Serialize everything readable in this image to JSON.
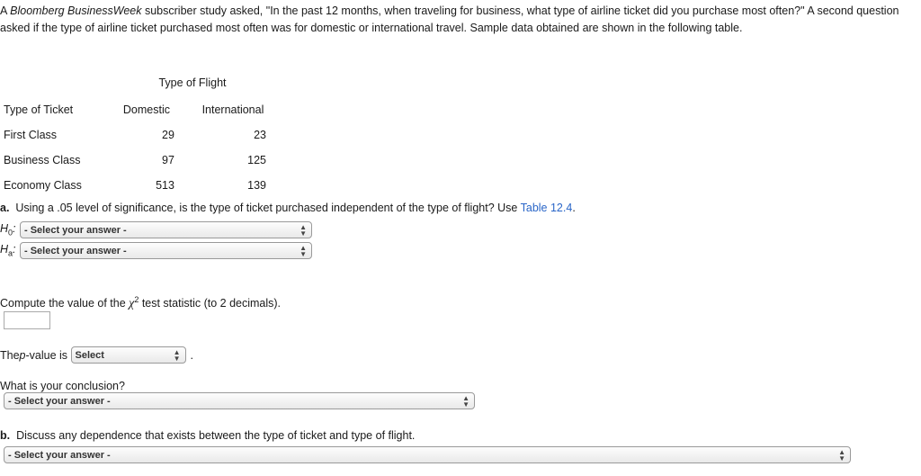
{
  "intro": {
    "line1_a": "A ",
    "brand": "Bloomberg BusinessWeek",
    "line1_b": " subscriber study asked, \"In the past 12 months, when traveling for business, what type of airline ticket did you purchase most often?\" A second question asked if the type of airline ticket purchased most often was for domestic or international travel. Sample data obtained are shown in the following table."
  },
  "table": {
    "span_header": "Type of Flight",
    "row_header": "Type of Ticket",
    "columns": [
      "Domestic",
      "International"
    ],
    "rows": [
      {
        "label": "First Class",
        "domestic": "29",
        "international": "23"
      },
      {
        "label": "Business Class",
        "domestic": "97",
        "international": "125"
      },
      {
        "label": "Economy Class",
        "domestic": "513",
        "international": "139"
      }
    ]
  },
  "part_a": {
    "marker": "a.",
    "text": "Using a .05 level of significance, is the type of ticket purchased independent of the type of flight? Use ",
    "link": "Table 12.4",
    "period": ".",
    "h0_label": "H",
    "h0_sub": "0",
    "h0_colon": ":",
    "ha_label": "H",
    "ha_sub": "a",
    "ha_colon": ":",
    "select_placeholder": "- Select your answer -"
  },
  "chi_question": {
    "before": "Compute the value of the ",
    "chi": "χ",
    "sup": "2",
    "after": " test statistic (to 2 decimals).",
    "answer_value": ""
  },
  "pvalue": {
    "prefix_a": "The ",
    "prefix_p": "p",
    "prefix_b": "-value is",
    "select_placeholder": "Select",
    "suffix": "."
  },
  "conclusion": {
    "question": "What is your conclusion?",
    "select_placeholder": "- Select your answer -"
  },
  "part_b": {
    "marker": "b.",
    "text": "Discuss any dependence that exists between the type of ticket and type of flight.",
    "select_placeholder": "- Select your answer -"
  },
  "icons": {
    "stepper": "▲▼"
  }
}
